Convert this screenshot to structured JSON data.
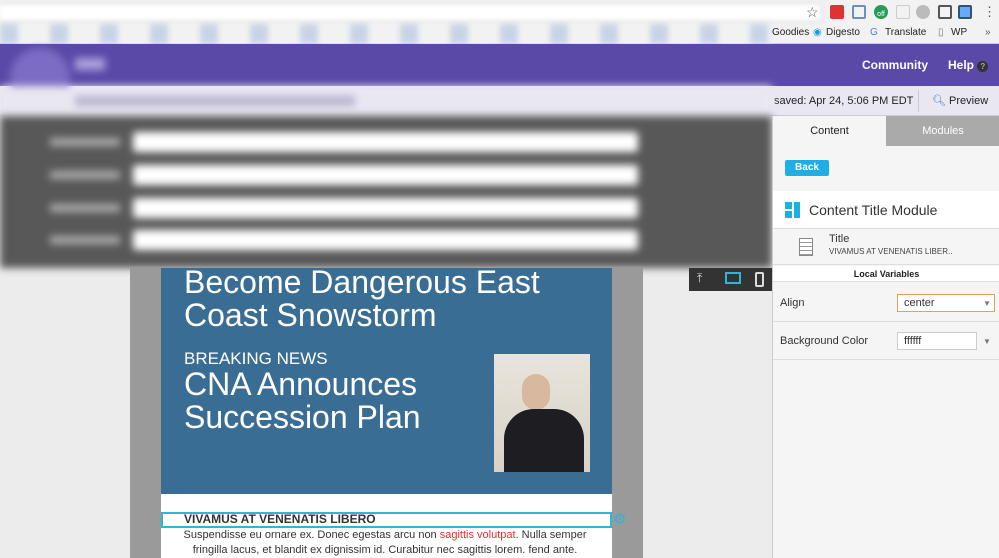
{
  "browser": {
    "bookmarks": [
      {
        "label": "Goodies"
      },
      {
        "label": "Digesto"
      },
      {
        "label": "Translate"
      },
      {
        "label": "WP"
      }
    ],
    "more": "»",
    "ext_off": "off"
  },
  "header": {
    "community": "Community",
    "help": "Help",
    "brand_color": "#5b49a8"
  },
  "toolbar": {
    "saved": "saved: Apr 24, 5:06 PM EDT",
    "preview": "Preview"
  },
  "email": {
    "hero_title": "Become Dangerous East Coast Snowstorm",
    "breaking": "BREAKING NEWS",
    "hero_title2": "CNA Announces Succession Plan",
    "section_title": "VIVAMUS AT VENENATIS LIBERO",
    "body_pre": "Suspendisse eu ornare ex. Donec egestas arcu non ",
    "body_link": "sagittis volutpat",
    "body_post": ". Nulla semper fringilla lacus, et blandit ex dignissim id. Curabitur nec sagittis lorem. fend ante.",
    "hero_color": "#3a6d94"
  },
  "panel": {
    "tabs": [
      {
        "label": "Content"
      },
      {
        "label": "Modules"
      }
    ],
    "back": "Back",
    "module_name": "Content Title Module",
    "title_label": "Title",
    "title_value": "VIVAMUS AT VENENATIS LIBER..",
    "local_vars": "Local Variables",
    "vars": [
      {
        "label": "Align",
        "value": "center"
      },
      {
        "label": "Background Color",
        "value": "ffffff"
      }
    ]
  }
}
